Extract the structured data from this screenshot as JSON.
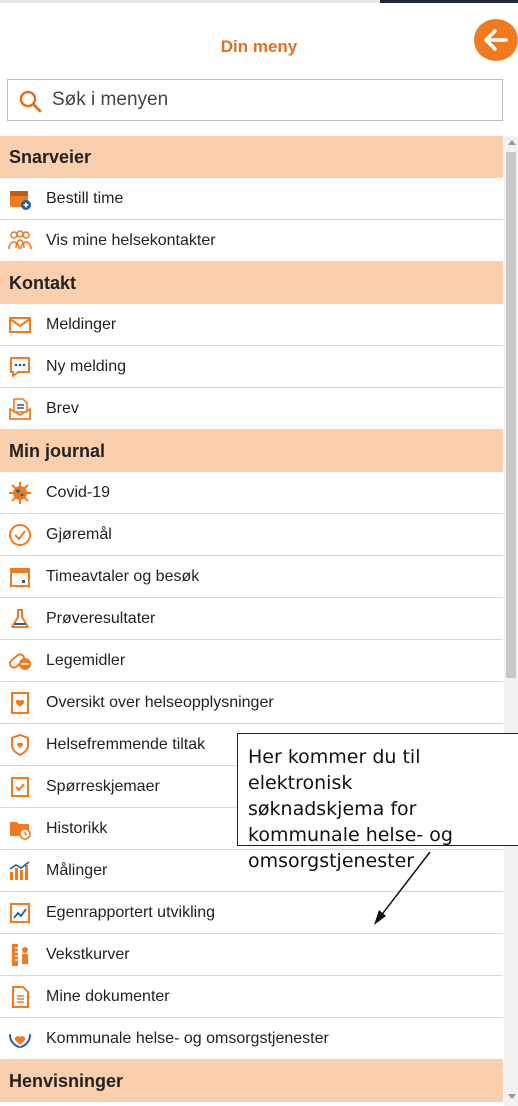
{
  "header": {
    "title": "Din meny",
    "back_icon": "arrow-left-icon"
  },
  "search": {
    "placeholder": "Søk i menyen"
  },
  "colors": {
    "accent": "#f07a20",
    "title": "#e07020",
    "section_bg": "#f9cfad"
  },
  "sections": [
    {
      "label": "Snarveier",
      "items": [
        {
          "label": "Bestill time",
          "icon": "calendar-plus-icon"
        },
        {
          "label": "Vis mine helsekontakter",
          "icon": "people-icon"
        }
      ]
    },
    {
      "label": "Kontakt",
      "items": [
        {
          "label": "Meldinger",
          "icon": "envelope-icon"
        },
        {
          "label": "Ny melding",
          "icon": "chat-icon"
        },
        {
          "label": "Brev",
          "icon": "letter-icon"
        }
      ]
    },
    {
      "label": "Min journal",
      "items": [
        {
          "label": "Covid-19",
          "icon": "virus-icon"
        },
        {
          "label": "Gjøremål",
          "icon": "check-circle-icon"
        },
        {
          "label": "Timeavtaler og besøk",
          "icon": "calendar-icon"
        },
        {
          "label": "Prøveresultater",
          "icon": "flask-icon"
        },
        {
          "label": "Legemidler",
          "icon": "pill-icon"
        },
        {
          "label": "Oversikt over helseopplysninger",
          "icon": "heart-document-icon"
        },
        {
          "label": "Helsefremmende tiltak",
          "icon": "shield-heart-icon"
        },
        {
          "label": "Spørreskjemaer",
          "icon": "checkbox-icon"
        },
        {
          "label": "Historikk",
          "icon": "folder-clock-icon"
        },
        {
          "label": "Målinger",
          "icon": "bar-chart-icon"
        },
        {
          "label": "Egenrapportert utvikling",
          "icon": "line-chart-icon"
        },
        {
          "label": "Vekstkurver",
          "icon": "ruler-icon"
        },
        {
          "label": "Mine dokumenter",
          "icon": "document-icon"
        },
        {
          "label": "Kommunale helse- og omsorgstjenester",
          "icon": "heart-hands-icon"
        }
      ]
    },
    {
      "label": "Henvisninger",
      "items": []
    }
  ],
  "callout": {
    "text": "Her kommer du til\nelektronisk\nsøknadskjema for\nkommunale helse- og\nomsorgstjenester"
  }
}
